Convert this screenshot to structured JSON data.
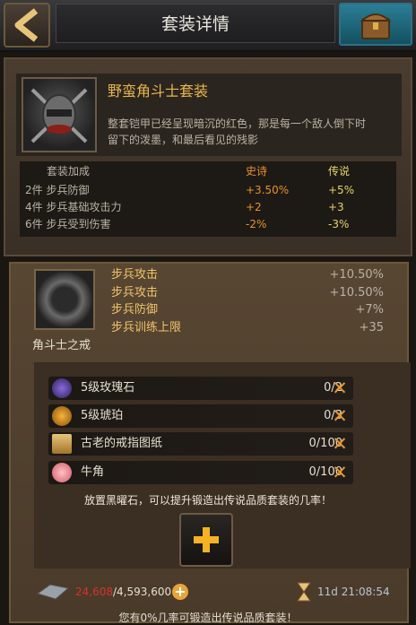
{
  "header": {
    "title": "套装详情"
  },
  "set": {
    "name": "野蛮角斗士套装",
    "desc_line1": "整套铠甲已经呈现暗沉的红色，那是每一个敌人倒下时",
    "desc_line2": "留下的泼墨，和最后看见的残影",
    "table": {
      "header": [
        "套装加成",
        "史诗",
        "传说"
      ],
      "rows": [
        {
          "label": "2件 步兵防御",
          "epic": "+3.50%",
          "legend": "+5%"
        },
        {
          "label": "4件 步兵基础攻击力",
          "epic": "+2",
          "legend": "+3"
        },
        {
          "label": "6件 步兵受到伤害",
          "epic": "-2%",
          "legend": "-3%"
        }
      ]
    }
  },
  "item": {
    "name": "角斗士之戒",
    "stats": [
      {
        "label": "步兵攻击",
        "value": "+10.50%"
      },
      {
        "label": "步兵攻击",
        "value": "+10.50%"
      },
      {
        "label": "步兵防御",
        "value": "+7%"
      },
      {
        "label": "步兵训练上限",
        "value": "+35"
      }
    ]
  },
  "materials": [
    {
      "name": "5级玫瑰石",
      "count": "0/2",
      "icon": "rose-stone-icon"
    },
    {
      "name": "5级琥珀",
      "count": "0/3",
      "icon": "amber-icon"
    },
    {
      "name": "古老的戒指图纸",
      "count": "0/100",
      "icon": "ring-blueprint-icon"
    },
    {
      "name": "牛角",
      "count": "0/100",
      "icon": "horn-icon"
    }
  ],
  "hint": "放置黑曜石，可以提升锻造出传说品质套装的几率！",
  "resources": {
    "current": "24,608",
    "max": "/4,593,600"
  },
  "timer": "11d 21:08:54",
  "bottom_text": "您有0%几率可锻造出传说品质套装！",
  "colors": {
    "gold": "#f0c46b",
    "orange": "#e6932c",
    "yellow": "#e8d46a",
    "red": "#d9322b"
  }
}
